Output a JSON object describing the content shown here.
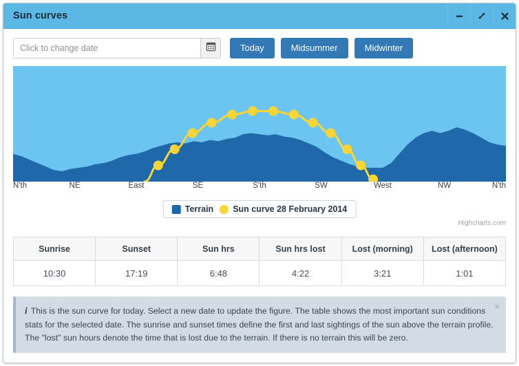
{
  "window": {
    "title": "Sun curves",
    "controls": [
      {
        "name": "minimize-button",
        "icon": "minimize-icon"
      },
      {
        "name": "expand-button",
        "icon": "expand-diagonal-icon"
      },
      {
        "name": "close-button",
        "icon": "close-icon"
      }
    ]
  },
  "toolbar": {
    "date_placeholder": "Click to change date",
    "date_value": "",
    "calendar_icon": "calendar-icon",
    "buttons": [
      {
        "label": "Today"
      },
      {
        "label": "Midsummer"
      },
      {
        "label": "Midwinter"
      }
    ]
  },
  "chart_data": {
    "type": "area",
    "title": "",
    "subtitle": "",
    "xlabel": "",
    "ylabel": "",
    "credits": "Highcharts.com",
    "grid": false,
    "legend_position": "bottom-center",
    "xlim": [
      0,
      360
    ],
    "ylim": [
      0,
      100
    ],
    "categories": [
      "N'th",
      "NE",
      "East",
      "SE",
      "S'th",
      "SW",
      "West",
      "NW",
      "N'th"
    ],
    "tick_values": [
      0,
      45,
      90,
      135,
      180,
      225,
      270,
      315,
      360
    ],
    "colors": {
      "sky": "#6CC5F0",
      "terrain": "#1F69AA",
      "sun": "#FBD535",
      "plot_border": "#ffffff"
    },
    "series": [
      {
        "name": "Terrain",
        "type": "area",
        "color": "#1F69AA",
        "x": [
          0,
          6,
          12,
          18,
          24,
          30,
          36,
          42,
          48,
          54,
          60,
          66,
          72,
          78,
          84,
          90,
          96,
          102,
          108,
          114,
          120,
          126,
          132,
          138,
          144,
          150,
          156,
          162,
          168,
          174,
          180,
          186,
          192,
          198,
          204,
          210,
          216,
          222,
          228,
          234,
          240,
          246,
          252,
          258,
          264,
          270,
          276,
          282,
          288,
          294,
          300,
          306,
          312,
          318,
          324,
          330,
          336,
          342,
          348,
          354,
          360
        ],
        "values": [
          24,
          22,
          19,
          16,
          13,
          10,
          9,
          11,
          12,
          13,
          15,
          16,
          18,
          21,
          23,
          24,
          26,
          29,
          31,
          33,
          34,
          33,
          35,
          34,
          36,
          35,
          37,
          38,
          41,
          42,
          41,
          40,
          41,
          39,
          38,
          36,
          33,
          30,
          25,
          21,
          18,
          15,
          13,
          12,
          12,
          12,
          16,
          24,
          32,
          38,
          42,
          44,
          42,
          44,
          47,
          45,
          42,
          38,
          34,
          32,
          31
        ]
      },
      {
        "name": "Sun curve 28 February 2014",
        "type": "line",
        "color": "#FBD535",
        "marker": "circle",
        "points": [
          {
            "x": 96,
            "y": 0,
            "label": ""
          },
          {
            "x": 106,
            "y": 14
          },
          {
            "x": 118,
            "y": 28
          },
          {
            "x": 131,
            "y": 42
          },
          {
            "x": 145,
            "y": 51
          },
          {
            "x": 160,
            "y": 58
          },
          {
            "x": 175,
            "y": 61
          },
          {
            "x": 190,
            "y": 61
          },
          {
            "x": 205,
            "y": 58
          },
          {
            "x": 219,
            "y": 51
          },
          {
            "x": 232,
            "y": 42
          },
          {
            "x": 244,
            "y": 28
          },
          {
            "x": 254,
            "y": 14
          },
          {
            "x": 263,
            "y": 2
          }
        ]
      }
    ],
    "legend": [
      {
        "label": "Terrain",
        "color": "#1F69AA",
        "marker": "square"
      },
      {
        "label": "Sun curve 28 February 2014",
        "color": "#FBD535",
        "marker": "circle"
      }
    ]
  },
  "table": {
    "headers": [
      "Sunrise",
      "Sunset",
      "Sun hrs",
      "Sun hrs lost",
      "Lost (morning)",
      "Lost (afternoon)"
    ],
    "rows": [
      [
        "10:30",
        "17:19",
        "6:48",
        "4:22",
        "3:21",
        "1:01"
      ]
    ]
  },
  "alert": {
    "icon": "info-icon",
    "text": "This is the sun curve for today. Select a new date to update the figure. The table shows the most important sun conditions stats for the selected date. The sunrise and sunset times define the first and last sightings of the sun above the terrain profile. The \"lost\" sun hours denote the time that is lost due to the terrain. If there is no terrain this will be zero.",
    "close_label": "×"
  }
}
